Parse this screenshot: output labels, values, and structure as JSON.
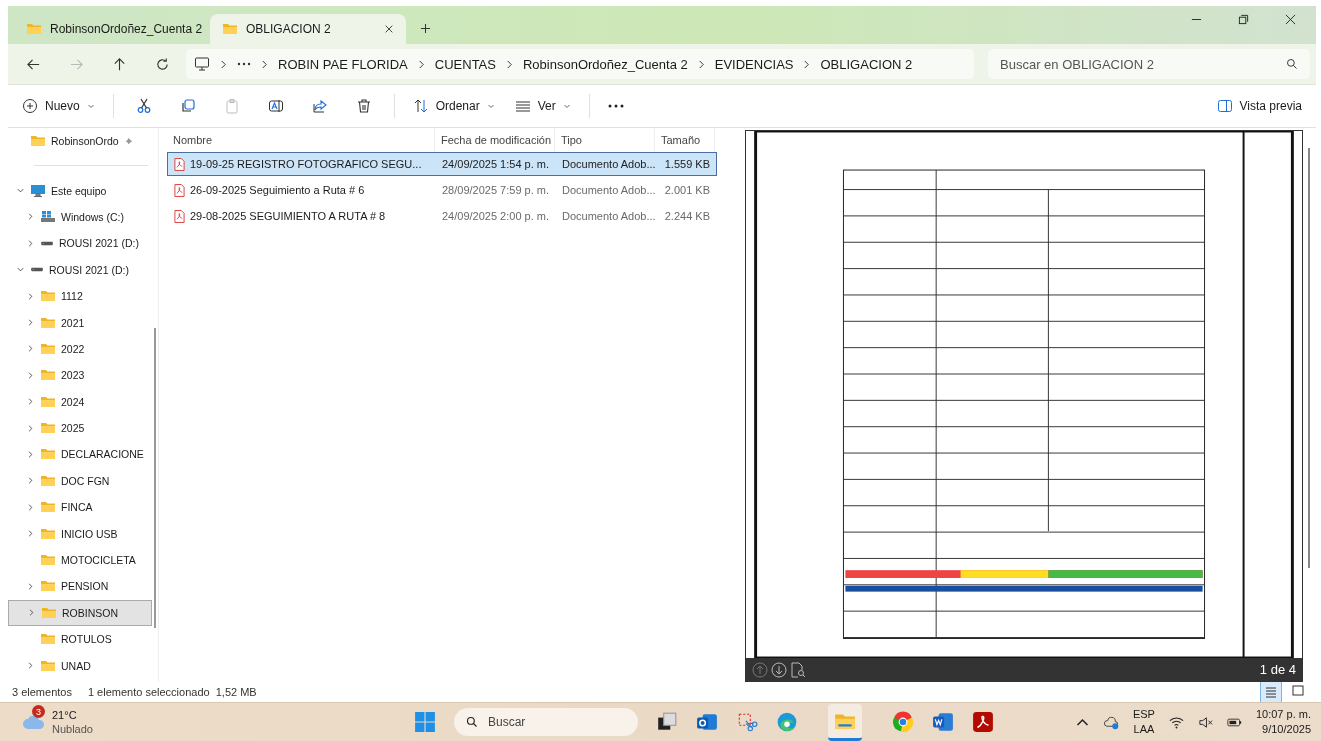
{
  "tabs": [
    {
      "label": "RobinsonOrdoñez_Cuenta 2",
      "selected": false
    },
    {
      "label": "OBLIGACION 2",
      "selected": true
    }
  ],
  "breadcrumb": [
    "ROBIN PAE FLORIDA",
    "CUENTAS",
    "RobinsonOrdoñez_Cuenta 2",
    "EVIDENCIAS",
    "OBLIGACION 2"
  ],
  "search": {
    "placeholder": "Buscar en OBLIGACION 2"
  },
  "toolbar": {
    "new": "Nuevo",
    "sort": "Ordenar",
    "view": "Ver",
    "preview": "Vista previa"
  },
  "sidebar": [
    {
      "label": "RobinsonOrdo",
      "kind": "pinned",
      "expandable": false,
      "expanded": false,
      "selected": false
    },
    {
      "label": "Este equipo",
      "kind": "pc",
      "expandable": true,
      "expanded": true,
      "selected": false,
      "children": [
        {
          "label": "Windows (C:)",
          "kind": "windrive",
          "expandable": true,
          "expanded": false,
          "selected": false
        },
        {
          "label": "ROUSI 2021 (D:)",
          "kind": "drive",
          "expandable": true,
          "expanded": false,
          "selected": false
        }
      ]
    },
    {
      "label": "ROUSI 2021 (D:)",
      "kind": "drive",
      "expandable": true,
      "expanded": true,
      "selected": false,
      "children": [
        {
          "label": "1112",
          "kind": "folder",
          "expandable": true,
          "expanded": false,
          "selected": false
        },
        {
          "label": "2021",
          "kind": "folder",
          "expandable": true,
          "expanded": false,
          "selected": false
        },
        {
          "label": "2022",
          "kind": "folder",
          "expandable": true,
          "expanded": false,
          "selected": false
        },
        {
          "label": "2023",
          "kind": "folder",
          "expandable": true,
          "expanded": false,
          "selected": false
        },
        {
          "label": "2024",
          "kind": "folder",
          "expandable": true,
          "expanded": false,
          "selected": false
        },
        {
          "label": "2025",
          "kind": "folder",
          "expandable": true,
          "expanded": false,
          "selected": false
        },
        {
          "label": "DECLARACIONE",
          "kind": "folder",
          "expandable": true,
          "expanded": false,
          "selected": false
        },
        {
          "label": "DOC FGN",
          "kind": "folder",
          "expandable": true,
          "expanded": false,
          "selected": false
        },
        {
          "label": "FINCA",
          "kind": "folder",
          "expandable": true,
          "expanded": false,
          "selected": false
        },
        {
          "label": "INICIO USB",
          "kind": "folder",
          "expandable": true,
          "expanded": false,
          "selected": false
        },
        {
          "label": "MOTOCICLETA",
          "kind": "folder",
          "expandable": false,
          "expanded": false,
          "selected": false
        },
        {
          "label": "PENSION",
          "kind": "folder",
          "expandable": true,
          "expanded": false,
          "selected": false
        },
        {
          "label": "ROBINSON",
          "kind": "folder",
          "expandable": true,
          "expanded": false,
          "selected": true
        },
        {
          "label": "ROTULOS",
          "kind": "folder",
          "expandable": false,
          "expanded": false,
          "selected": false
        },
        {
          "label": "UNAD",
          "kind": "folder",
          "expandable": true,
          "expanded": false,
          "selected": false
        }
      ]
    }
  ],
  "table": {
    "columns": [
      "Nombre",
      "Fecha de modificación",
      "Tipo",
      "Tamaño"
    ],
    "rows": [
      {
        "name": "19-09-25 REGISTRO FOTOGRAFICO SEGU...",
        "date": "24/09/2025 1:54 p. m.",
        "type": "Documento Adob...",
        "size": "1.559 KB",
        "selected": true
      },
      {
        "name": "26-09-2025 Seguimiento a Ruta # 6",
        "date": "28/09/2025 7:59 p. m.",
        "type": "Documento Adob...",
        "size": "2.001 KB",
        "selected": false
      },
      {
        "name": "29-08-2025 SEGUIMIENTO A RUTA # 8",
        "date": "24/09/2025 2:00 p. m.",
        "type": "Documento Adob...",
        "size": "2.244 KB",
        "selected": false
      }
    ]
  },
  "preview": {
    "page": "1 de 4"
  },
  "status_bar": [
    "3 elementos",
    "1 elemento seleccionado  1,52 MB"
  ],
  "taskbar": {
    "weather_badge": "3",
    "temperature": "21°C",
    "condition": "Nublado",
    "search": "Buscar",
    "lang1": "ESP",
    "lang2": "LAA",
    "time": "10:07 p. m.",
    "date": "9/10/2025"
  }
}
